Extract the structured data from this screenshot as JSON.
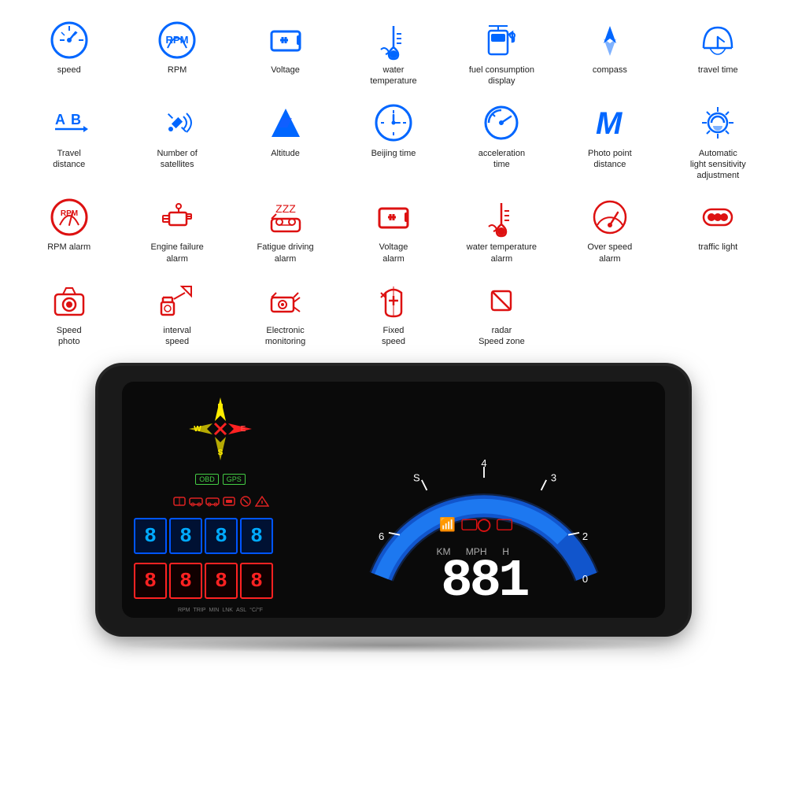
{
  "icons": {
    "row1": [
      {
        "id": "speed",
        "label": "speed",
        "color": "blue",
        "symbol": "🕐"
      },
      {
        "id": "rpm",
        "label": "RPM",
        "color": "blue",
        "symbol": "RPM"
      },
      {
        "id": "voltage",
        "label": "Voltage",
        "color": "blue",
        "symbol": "⬛"
      },
      {
        "id": "water-temp",
        "label": "water\ntemperature",
        "color": "blue",
        "symbol": "🌡"
      },
      {
        "id": "fuel",
        "label": "fuel consumption\ndisplay",
        "color": "blue",
        "symbol": "⛽"
      },
      {
        "id": "compass",
        "label": "compass",
        "color": "blue",
        "symbol": "▲"
      },
      {
        "id": "travel-time",
        "label": "travel time",
        "color": "blue",
        "symbol": "🕐"
      }
    ],
    "row2": [
      {
        "id": "travel-dist",
        "label": "Travel\ndistance",
        "color": "blue",
        "symbol": "AB"
      },
      {
        "id": "satellites",
        "label": "Number of\nsatellites",
        "color": "blue",
        "symbol": "📡"
      },
      {
        "id": "altitude",
        "label": "Altitude",
        "color": "blue",
        "symbol": "▲"
      },
      {
        "id": "beijing-time",
        "label": "Beijing time",
        "color": "blue",
        "symbol": "🕐"
      },
      {
        "id": "accel-time",
        "label": "acceleration\ntime",
        "color": "blue",
        "symbol": "⊙"
      },
      {
        "id": "photo-point",
        "label": "Photo point\ndistance",
        "color": "blue",
        "symbol": "M"
      },
      {
        "id": "auto-light",
        "label": "Automatic\nlight sensitivity\nadjustment",
        "color": "blue",
        "symbol": "☀"
      }
    ],
    "row3": [
      {
        "id": "rpm-alarm",
        "label": "RPM alarm",
        "color": "red",
        "symbol": "RPM"
      },
      {
        "id": "engine-fail",
        "label": "Engine failure\nalarm",
        "color": "red",
        "symbol": "🔧"
      },
      {
        "id": "fatigue",
        "label": "Fatigue driving\nalarm",
        "color": "red",
        "symbol": "🚗"
      },
      {
        "id": "voltage-alarm",
        "label": "Voltage\nalarm",
        "color": "red",
        "symbol": "⬛"
      },
      {
        "id": "water-alarm",
        "label": "water temperature\nalarm",
        "color": "red",
        "symbol": "🌡"
      },
      {
        "id": "overspeed",
        "label": "Over speed\nalarm",
        "color": "red",
        "symbol": "⊙"
      },
      {
        "id": "traffic",
        "label": "traffic light",
        "color": "red",
        "symbol": "🔴"
      }
    ],
    "row4": [
      {
        "id": "speed-photo",
        "label": "Speed\nphoto",
        "color": "red",
        "symbol": "📷"
      },
      {
        "id": "interval",
        "label": "interval\nspeed",
        "color": "red",
        "symbol": "📷"
      },
      {
        "id": "electronic",
        "label": "Electronic\nmonitoring",
        "color": "red",
        "symbol": "📷"
      },
      {
        "id": "fixed-speed",
        "label": "Fixed\nspeed",
        "color": "red",
        "symbol": "🔴"
      },
      {
        "id": "radar",
        "label": "radar\nSpeed zone",
        "color": "red",
        "symbol": "🚫"
      },
      {
        "id": "empty6",
        "label": "",
        "color": "blue",
        "symbol": ""
      },
      {
        "id": "empty7",
        "label": "",
        "color": "blue",
        "symbol": ""
      }
    ]
  },
  "hud": {
    "compass": {
      "n": "N",
      "s": "S",
      "e": "E",
      "w": "W"
    },
    "tags": [
      "OBD",
      "GPS"
    ],
    "speed_digits": [
      "8",
      "8",
      "1"
    ],
    "extra_digits": [
      "8",
      "8",
      "8",
      "8"
    ],
    "units": "KM  MPH  H",
    "bottom_labels": "RPM  TRIP  MIN  LNK  ASL  °C/°F",
    "arc_labels": [
      "4",
      "3",
      "2",
      "S",
      "6",
      "0"
    ]
  }
}
